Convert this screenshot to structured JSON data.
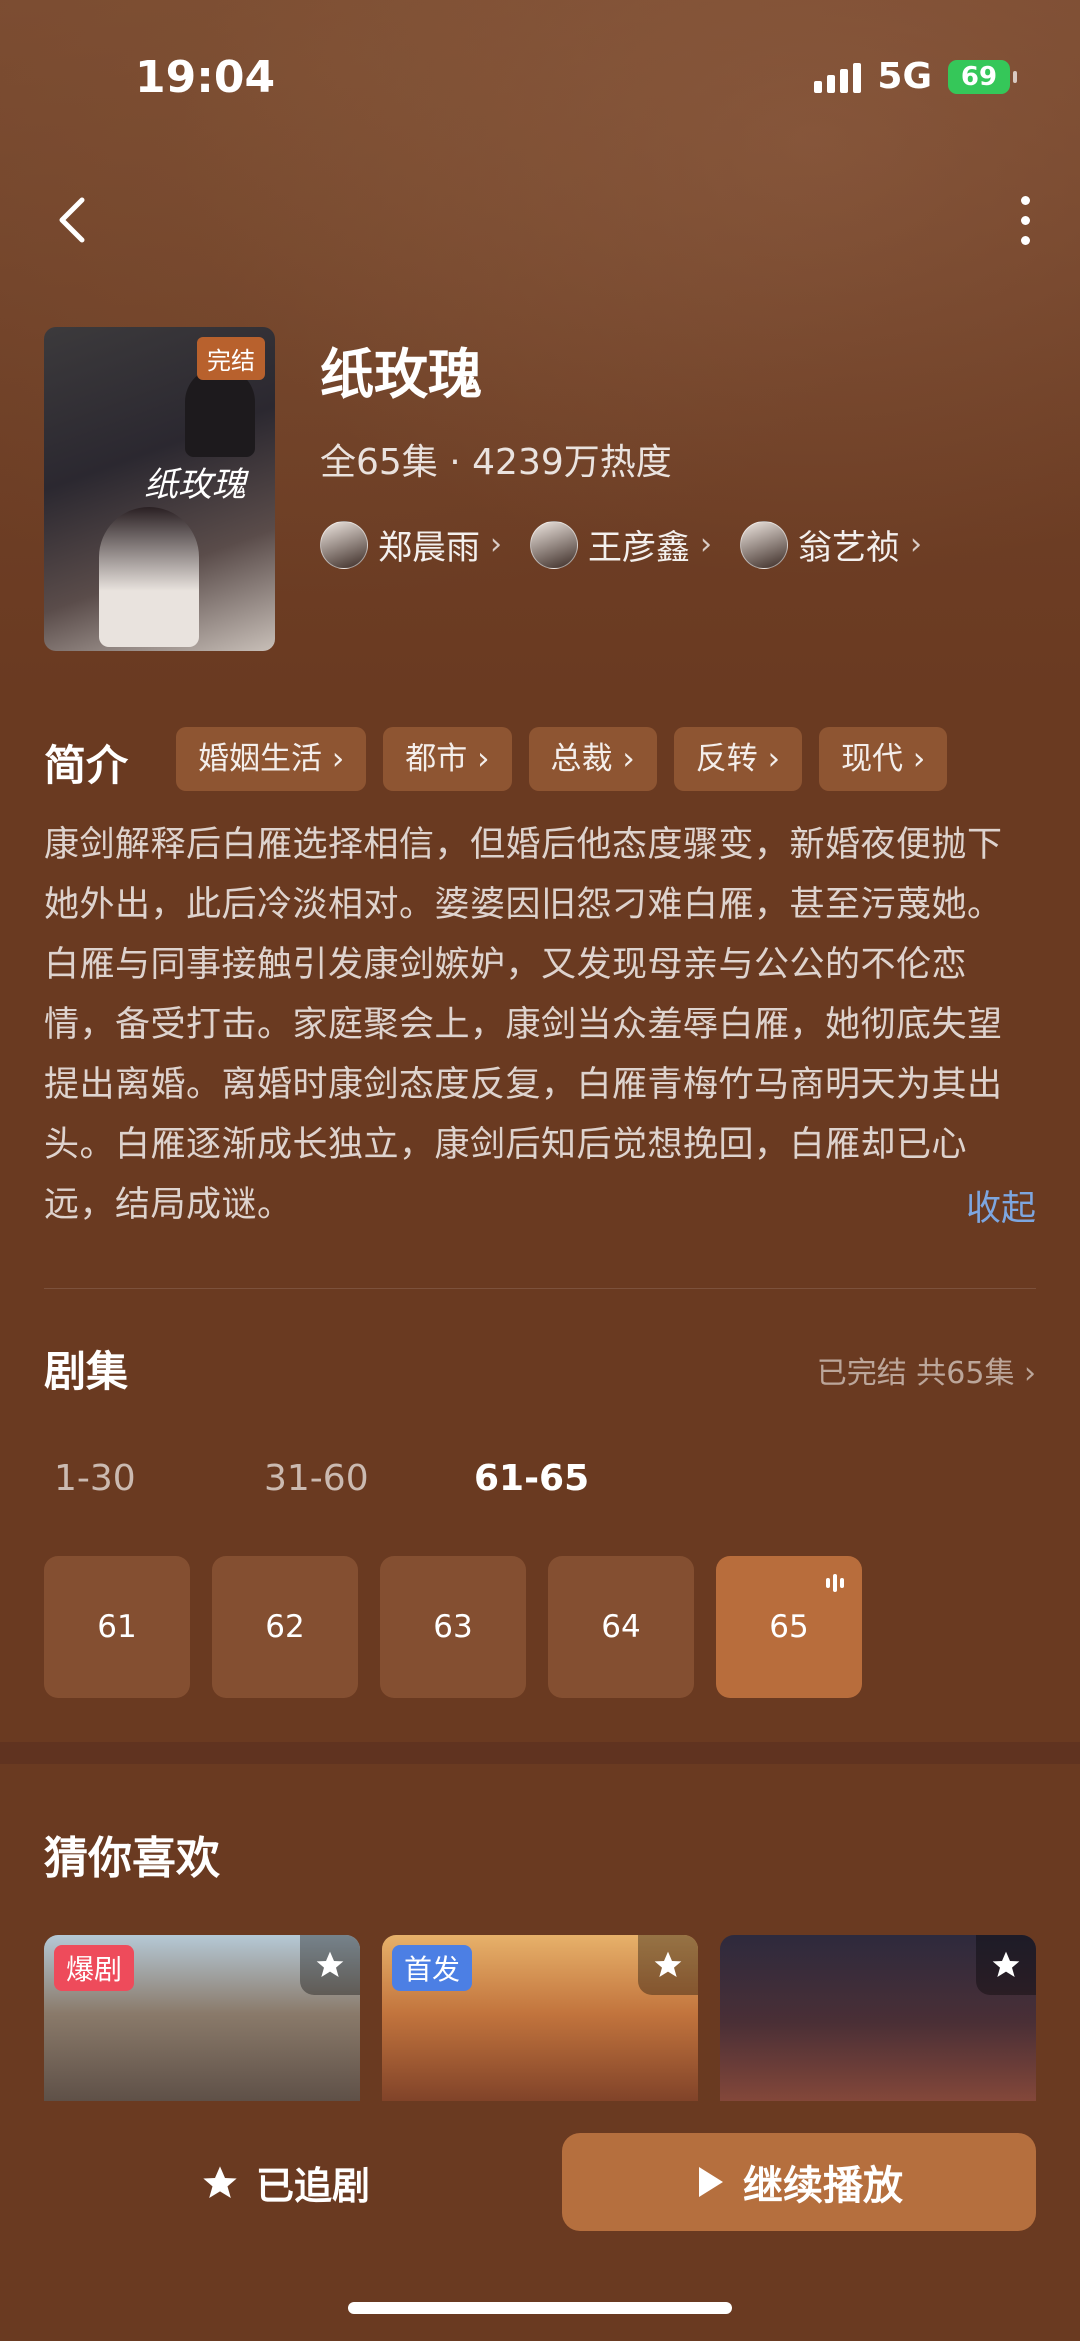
{
  "status_bar": {
    "time": "19:04",
    "network": "5G",
    "battery": "69"
  },
  "drama": {
    "title": "纸玫瑰",
    "poster_badge": "完结",
    "meta": "全65集 · 4239万热度",
    "cast": [
      {
        "name": "郑晨雨"
      },
      {
        "name": "王彦鑫"
      },
      {
        "name": "翁艺祯"
      }
    ]
  },
  "intro": {
    "label": "简介",
    "tags": [
      "婚姻生活",
      "都市",
      "总裁",
      "反转",
      "现代"
    ],
    "text": "康剑解释后白雁选择相信，但婚后他态度骤变，新婚夜便抛下她外出，此后冷淡相对。婆婆因旧怨刁难白雁，甚至污蔑她。白雁与同事接触引发康剑嫉妒，又发现母亲与公公的不伦恋情，备受打击。家庭聚会上，康剑当众羞辱白雁，她彻底失望提出离婚。离婚时康剑态度反复，白雁青梅竹马商明天为其出头。白雁逐渐成长独立，康剑后知后觉想挽回，白雁却已心远，结局成谜。",
    "collapse_label": "收起"
  },
  "episodes": {
    "title": "剧集",
    "status": "已完结 共65集",
    "ranges": [
      "1-30",
      "31-60",
      "61-65"
    ],
    "active_range": 2,
    "items": [
      "61",
      "62",
      "63",
      "64",
      "65"
    ],
    "playing_index": 4
  },
  "recommend": {
    "title": "猜你喜欢",
    "cards": [
      {
        "badge": "爆剧"
      },
      {
        "badge": "首发"
      },
      {
        "badge": ""
      }
    ]
  },
  "bottom": {
    "follow_label": "已追剧",
    "play_label": "继续播放"
  },
  "colors": {
    "background": "#6a3a21",
    "tag_bg": "#8e5532",
    "episode_bg": "#844f31",
    "episode_active": "#b86d3c",
    "play_button": "#b56f3e",
    "link": "#7da6e0"
  }
}
